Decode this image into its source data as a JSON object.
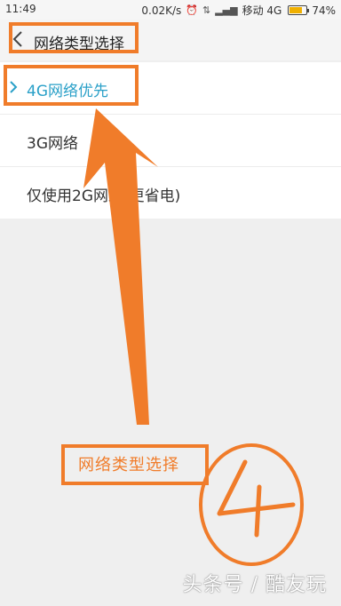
{
  "status_bar": {
    "time": "11:49",
    "speed": "0.02K/s",
    "carrier": "移动 4G",
    "battery": "74%",
    "battery_level": 0.74
  },
  "header": {
    "title": "网络类型选择"
  },
  "options": [
    {
      "label": "4G网络优先",
      "selected": true
    },
    {
      "label": "3G网络",
      "selected": false
    },
    {
      "label": "仅使用2G网络(更省电)",
      "selected": false
    }
  ],
  "annotation": {
    "label": "网络类型选择",
    "number": "4",
    "color": "#f07c2a"
  },
  "watermark": "头条号 / 酷友玩",
  "colors": {
    "selected_text": "#2aa0c8",
    "background": "#efefef"
  }
}
